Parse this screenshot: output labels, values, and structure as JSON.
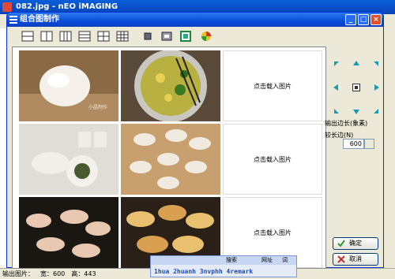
{
  "background_app": {
    "title": "082.jpg - nEO iMAGING",
    "status": {
      "output_label": "输出图片：",
      "width_text": "宽：600",
      "height_text": "高：443"
    }
  },
  "dialog": {
    "title": "组合图制作",
    "controls": {
      "minimize": "_",
      "maximize": "□",
      "close": "×"
    },
    "toolbar": [
      "layout-1-row-icon",
      "layout-2-col-icon",
      "layout-3-col-icon",
      "layout-2-row-icon",
      "layout-3-row-icon",
      "layout-grid-icon",
      "crop-icon",
      "fit-icon",
      "frame-icon",
      "color-icon"
    ],
    "empty_cell_text": "点击载入图片",
    "photo_caption": "小晶制作",
    "output_side_label": "输出边长(象素)",
    "long_side_label": "较长边(N)",
    "long_side_value": "600",
    "ok_label": "确定",
    "cancel_label": "取消"
  },
  "ime": {
    "search_label": "搜索",
    "web_label": "网址",
    "dict_label": "词",
    "input_text": "1hua 2huanh 3nvphh 4remark"
  },
  "colors": {
    "title_blue": "#0a4cd6",
    "dialog_bg": "#ece9d8",
    "ok_green": "#2e9a2e",
    "cancel_red": "#c83030"
  }
}
